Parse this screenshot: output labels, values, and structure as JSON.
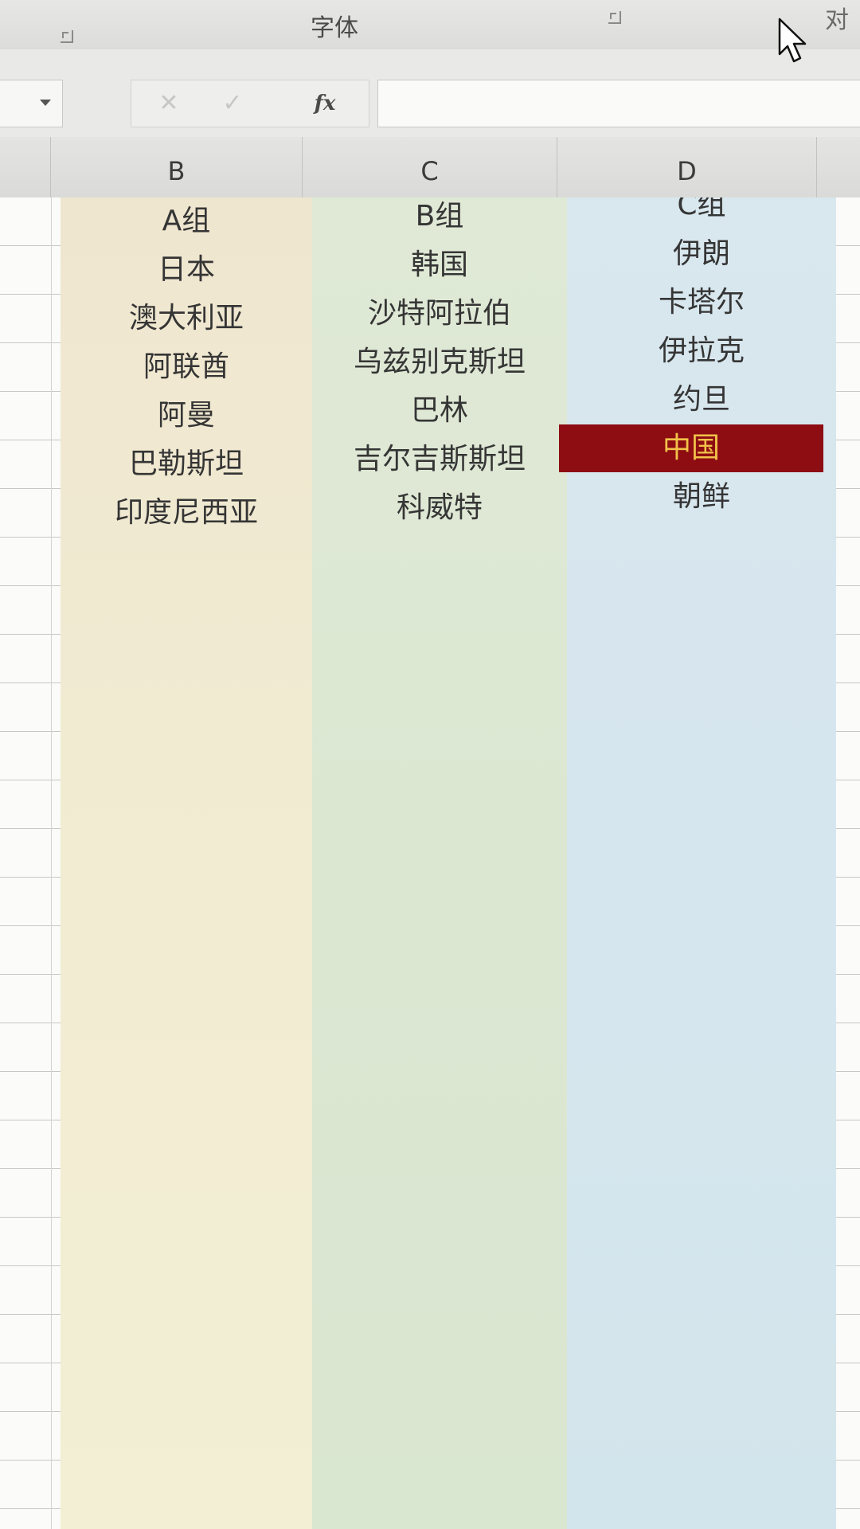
{
  "ribbon": {
    "group_label": "字体",
    "next_group_label_partial": "对",
    "icons": [
      "dialog-launcher-icon",
      "dialog-launcher-icon",
      "mouse-cursor-icon"
    ]
  },
  "formula_bar": {
    "name_box_value": "",
    "cancel_symbol": "✕",
    "enter_symbol": "✓",
    "fx_label": "fx",
    "formula_value": ""
  },
  "columns": [
    "",
    "B",
    "C",
    "D",
    ""
  ],
  "sheet": {
    "col_b": [
      "A组",
      "日本",
      "澳大利亚",
      "阿联酋",
      "阿曼",
      "巴勒斯坦",
      "印度尼西亚"
    ],
    "col_c": [
      "B组",
      "韩国",
      "沙特阿拉伯",
      "乌兹别克斯坦",
      "巴林",
      "吉尔吉斯斯坦",
      "科威特"
    ],
    "col_d": [
      "C组",
      "伊朗",
      "卡塔尔",
      "伊拉克",
      "约旦",
      "中国",
      "朝鲜"
    ]
  },
  "colors": {
    "col_b_fill": "#f1ebd2",
    "col_c_fill": "#dce7d2",
    "col_d_fill": "#d6e6ee",
    "highlight_fill": "#8d0d12",
    "highlight_text": "#f2c24a"
  }
}
